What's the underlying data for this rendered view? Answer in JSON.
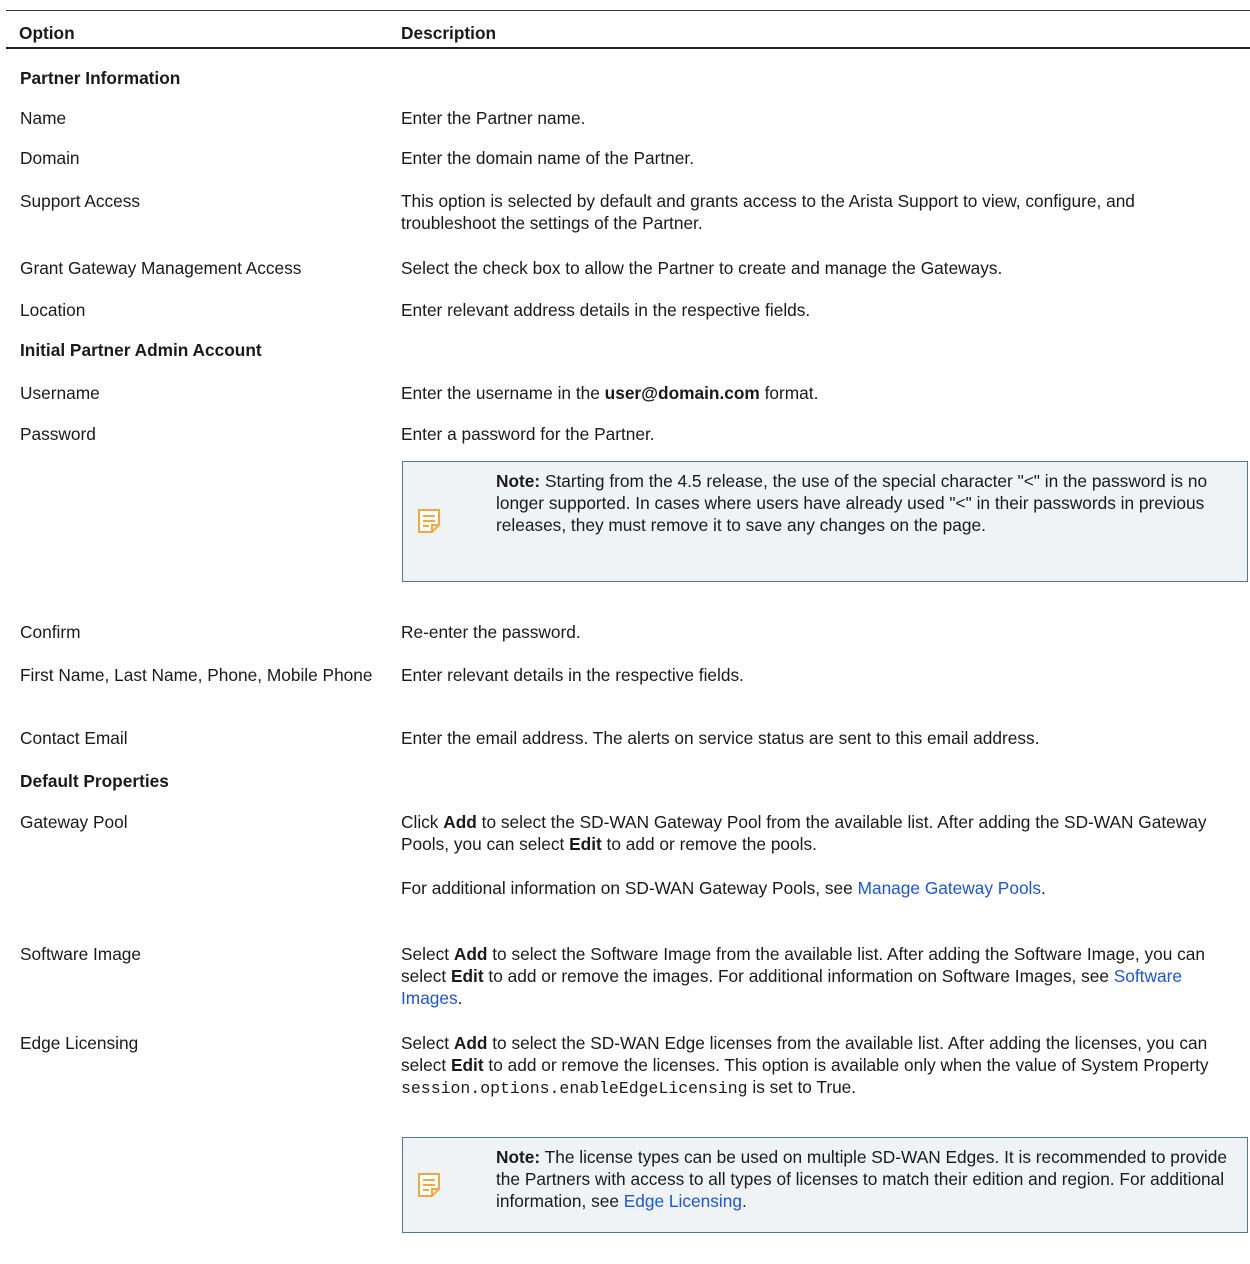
{
  "header": {
    "option": "Option",
    "description": "Description"
  },
  "sections": {
    "partner_info": "Partner Information",
    "admin_account": "Initial Partner Admin Account",
    "default_props": "Default Properties"
  },
  "rows": {
    "name": {
      "option": "Name",
      "desc": "Enter the Partner name."
    },
    "domain": {
      "option": "Domain",
      "desc": "Enter the domain name of the Partner."
    },
    "support": {
      "option": "Support Access",
      "desc": "This option is selected by default and grants access to the Arista Support to view, configure, and troubleshoot the settings of the Partner."
    },
    "grant": {
      "option": "Grant Gateway Management Access",
      "desc": "Select the check box to allow the Partner to create and manage the Gateways."
    },
    "location": {
      "option": "Location",
      "desc": "Enter relevant address details in the respective fields."
    },
    "username": {
      "option": "Username",
      "desc_a": "Enter the username in the ",
      "desc_b": "user@domain.com",
      "desc_c": " format."
    },
    "password": {
      "option": "Password",
      "desc": "Enter a password for the Partner."
    },
    "confirm": {
      "option": "Confirm",
      "desc": "Re-enter the password."
    },
    "names": {
      "option": "First Name, Last Name, Phone, Mobile Phone",
      "desc": "Enter relevant details in the respective fields."
    },
    "email": {
      "option": "Contact Email",
      "desc": "Enter the email address. The alerts on service status are sent to this email address."
    },
    "gateway_pool": {
      "option": "Gateway Pool",
      "d1": "Click ",
      "d2": "Add",
      "d3": " to select the SD-WAN Gateway Pool from the available list. After adding the SD-WAN Gateway Pools, you can select ",
      "d4": "Edit",
      "d5": " to add or remove the pools.",
      "p2": "For additional information on SD-WAN Gateway Pools, see ",
      "link": "Manage Gateway Pools",
      "p2_end": "."
    },
    "software_image": {
      "option": "Software Image",
      "d1": "Select ",
      "d2": "Add",
      "d3": " to select the Software Image from the available list. After adding the Software Image, you can select ",
      "d4": "Edit",
      "d5": " to add or remove the images. For additional information on Software Images, see ",
      "link": "Software Images",
      "d6": "."
    },
    "edge_licensing": {
      "option": "Edge Licensing",
      "d1": "Select ",
      "d2": "Add",
      "d3": " to select the SD-WAN Edge licenses from the available list. After adding the licenses, you can select ",
      "d4": "Edit",
      "d5": " to add or remove the licenses. This option is available only when the value of System Property ",
      "code": "session.options.enableEdgeLicensing",
      "d6": " is set to True."
    }
  },
  "notes": {
    "password": {
      "label": "Note:",
      "text": " Starting from the 4.5 release, the use of the special character \"<\" in the password is no longer supported. In cases where users have already used \"<\" in their passwords in previous releases, they must remove it to save any changes on the page."
    },
    "license": {
      "label": "Note:",
      "text": " The license types can be used on multiple SD-WAN Edges. It is recommended to provide the Partners with access to all types of licenses to match their edition and region. For additional information, see ",
      "link": "Edge Licensing",
      "end": "."
    }
  },
  "colors": {
    "link": "#1a56db",
    "note_bg": "#f0f3f6",
    "note_border": "#4e7a93",
    "note_icon": "#f2a83b"
  },
  "icons": {
    "note": "note-icon"
  }
}
